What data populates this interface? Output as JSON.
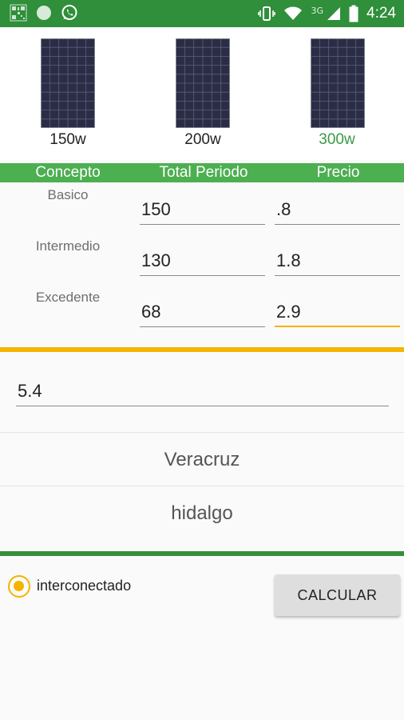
{
  "status_bar": {
    "time": "4:24",
    "network": "3G",
    "icons": [
      "qr-code-icon",
      "circle-icon",
      "whatsapp-icon",
      "vibrate-icon",
      "wifi-icon",
      "signal-icon",
      "battery-icon"
    ],
    "background": "#2f8f3a"
  },
  "panels": [
    {
      "label": "150w",
      "selected": false
    },
    {
      "label": "200w",
      "selected": false
    },
    {
      "label": "300w",
      "selected": true
    }
  ],
  "table": {
    "headers": [
      "Concepto",
      "Total Periodo",
      "Precio"
    ],
    "rows": [
      {
        "concept": "Basico",
        "total": "150",
        "price": ".8"
      },
      {
        "concept": "Intermedio",
        "total": "130",
        "price": "1.8"
      },
      {
        "concept": "Excedente",
        "total": "68",
        "price": "2.9"
      }
    ],
    "header_color": "#4caf50"
  },
  "extra_value": "5.4",
  "locations": [
    "Veracruz",
    "hidalgo"
  ],
  "radio": {
    "label": "interconectado",
    "checked": true
  },
  "calculate_button": "CALCULAR",
  "colors": {
    "accent": "#f4b400",
    "primary": "#388e3c",
    "selected_text": "#3a9a45"
  }
}
